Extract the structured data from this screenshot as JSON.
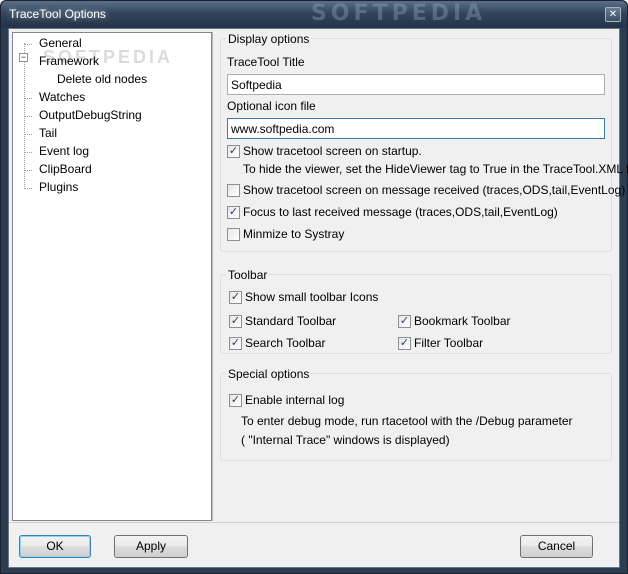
{
  "window": {
    "title": "TraceTool Options",
    "close_glyph": "✕",
    "watermark": "SOFTPEDIA"
  },
  "tree": {
    "watermark": "SOFTPEDIA",
    "expander_glyph": "−",
    "items": [
      {
        "label": "General"
      },
      {
        "label": "Framework"
      },
      {
        "label": "Delete old nodes"
      },
      {
        "label": "Watches"
      },
      {
        "label": "OutputDebugString"
      },
      {
        "label": "Tail"
      },
      {
        "label": "Event log"
      },
      {
        "label": "ClipBoard"
      },
      {
        "label": "Plugins"
      }
    ]
  },
  "display_options": {
    "group_label": "Display options",
    "title_label": "TraceTool Title",
    "title_value": "Softpedia",
    "icon_label": "Optional icon file",
    "icon_value": "www.softpedia.com",
    "show_on_startup": {
      "label": "Show tracetool screen on startup.",
      "checked": true
    },
    "hide_hint": "To hide the viewer, set the HideViewer tag to True in the TraceTool.XML file",
    "show_on_message": {
      "label": "Show tracetool screen on message received (traces,ODS,tail,EventLog)",
      "checked": false
    },
    "focus_last": {
      "label": "Focus to last received message (traces,ODS,tail,EventLog)",
      "checked": true
    },
    "minimize_systray": {
      "label": "Minmize to Systray",
      "checked": false
    }
  },
  "toolbar": {
    "group_label": "Toolbar",
    "small_icons": {
      "label": "Show small toolbar Icons",
      "checked": true
    },
    "standard": {
      "label": "Standard Toolbar",
      "checked": true
    },
    "bookmark": {
      "label": "Bookmark Toolbar",
      "checked": true
    },
    "search": {
      "label": "Search Toolbar",
      "checked": true
    },
    "filter": {
      "label": "Filter Toolbar",
      "checked": true
    }
  },
  "special": {
    "group_label": "Special options",
    "internal_log": {
      "label": "Enable internal log",
      "checked": true
    },
    "debug_hint": "To enter debug mode, run rtacetool with the /Debug parameter",
    "trace_hint": "( \"Internal Trace\" windows is displayed)"
  },
  "buttons": {
    "ok": "OK",
    "apply": "Apply",
    "cancel": "Cancel"
  },
  "check_glyph": "✓"
}
